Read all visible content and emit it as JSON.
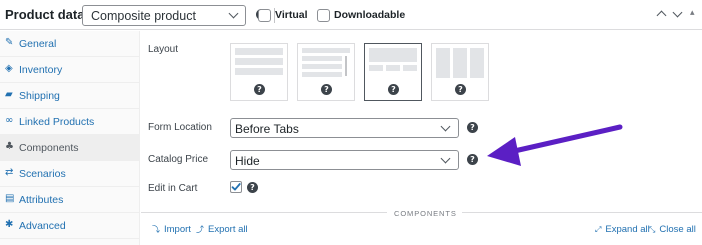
{
  "header": {
    "title": "Product data —",
    "product_type": "Composite product",
    "help": "?",
    "virtual_label": "Virtual",
    "virtual_checked": false,
    "downloadable_label": "Downloadable",
    "downloadable_checked": false,
    "arrows": [
      "⌃",
      "⌄",
      "▴"
    ]
  },
  "sidebar": {
    "items": [
      {
        "label": "General",
        "icon": "wrench-icon",
        "glyph": "✎",
        "active": false
      },
      {
        "label": "Inventory",
        "icon": "inventory-tag-icon",
        "glyph": "◈",
        "active": false
      },
      {
        "label": "Shipping",
        "icon": "truck-icon",
        "glyph": "▰",
        "active": false
      },
      {
        "label": "Linked Products",
        "icon": "link-icon",
        "glyph": "∞",
        "active": false
      },
      {
        "label": "Components",
        "icon": "components-icon",
        "glyph": "♣",
        "active": true
      },
      {
        "label": "Scenarios",
        "icon": "shuffle-icon",
        "glyph": "⇄",
        "active": false
      },
      {
        "label": "Attributes",
        "icon": "list-icon",
        "glyph": "▤",
        "active": false
      },
      {
        "label": "Advanced",
        "icon": "gear-icon",
        "glyph": "✱",
        "active": false
      }
    ]
  },
  "main": {
    "layout_label": "Layout",
    "layout_options": [
      {
        "name": "stacked",
        "help": "?",
        "selected": false
      },
      {
        "name": "progressive",
        "help": "?",
        "selected": false
      },
      {
        "name": "tabbed",
        "help": "?",
        "selected": true
      },
      {
        "name": "columns",
        "help": "?",
        "selected": false
      }
    ],
    "form_location_label": "Form Location",
    "form_location_value": "Before Tabs",
    "catalog_price_label": "Catalog Price",
    "catalog_price_value": "Hide",
    "edit_in_cart_label": "Edit in Cart",
    "edit_in_cart_checked": true,
    "components_heading": "COMPONENTS",
    "import_label": "Import",
    "export_label": "Export all",
    "expand_label": "Expand all",
    "close_label": "Close all"
  },
  "colors": {
    "link": "#2271b1",
    "annotation_arrow": "#5b1fc4",
    "active_tab_bg": "#eeeeee"
  }
}
